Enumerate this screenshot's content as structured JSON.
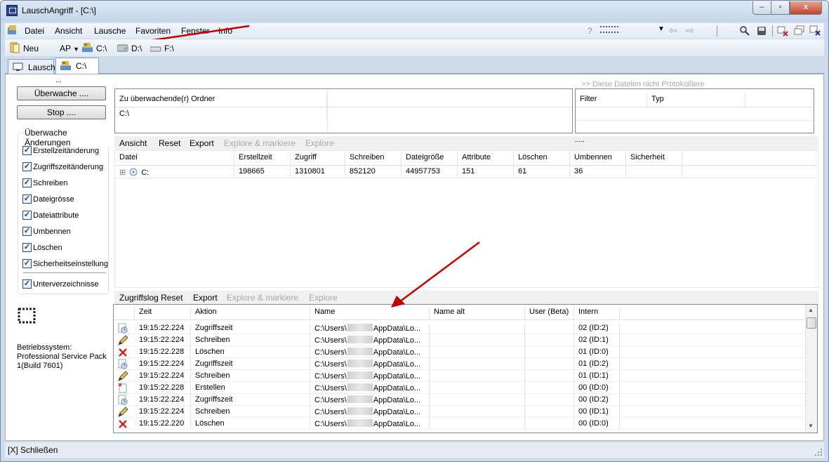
{
  "window": {
    "title": "LauschAngriff - [C:\\]",
    "min": "–",
    "max": "▫",
    "close": "x"
  },
  "menu": {
    "items": [
      "Datei",
      "Ansicht",
      "Lausche",
      "Favoriten",
      "Fenster",
      "Info"
    ],
    "help": "?"
  },
  "toolbar": {
    "new": "Neu",
    "ap": "AP",
    "drives": [
      "C:\\",
      "D:\\",
      "F:\\"
    ]
  },
  "tabs": [
    {
      "label": "Lausch"
    },
    {
      "label": "C:\\"
    }
  ],
  "left": {
    "dots": "...",
    "watch_button": "Überwache ....",
    "stop_button": "Stop ....",
    "group_label": "Überwache Änderungen",
    "checkboxes": [
      {
        "label": "Erstellzeitänderung",
        "checked": true
      },
      {
        "label": "Zugriffszeitänderung",
        "checked": true
      },
      {
        "label": "Schreiben",
        "checked": true
      },
      {
        "label": "Dateigrösse",
        "checked": true
      },
      {
        "label": "Dateiattribute",
        "checked": true
      },
      {
        "label": "Umbennen",
        "checked": true
      },
      {
        "label": "Löschen",
        "checked": true
      },
      {
        "label": "Sicherheitseinstellung",
        "checked": true
      }
    ],
    "subdirs": {
      "label": "Unterverzeichnisse",
      "checked": true
    },
    "os_label": "Betriebssystem:",
    "os_value": "Professional Service Pack 1(Build 7601)"
  },
  "folders": {
    "header": "Zu überwachende(r) Ordner",
    "value": "C:\\"
  },
  "exclude": {
    "title": ">> Diese Dateien nicht Protokolliere",
    "headers": [
      "Filter",
      "Typ"
    ]
  },
  "summary_bar": {
    "ansicht": "Ansicht",
    "reset": "Reset",
    "export": "Export",
    "explore_mark": "Explore & markiere",
    "explore": "Explore",
    "dots": "....."
  },
  "summary": {
    "headers": [
      "Datei",
      "Erstellzeit",
      "Zugriff",
      "Schreiben",
      "Dateigröße",
      "Attribute",
      "Löschen",
      "Umbennen",
      "Sicherheit"
    ],
    "row": {
      "expander": "⊞",
      "name": "C:",
      "values": [
        "198665",
        "1310801",
        "852120",
        "44957753",
        "151",
        "61",
        "36",
        ""
      ]
    }
  },
  "log_bar": {
    "reset": "Zugriffslog Reset",
    "export": "Export",
    "explore_mark": "Explore & markiere",
    "explore": "Explore"
  },
  "log": {
    "headers": [
      "Zeit",
      "Aktion",
      "Name",
      "Name alt",
      "User (Beta)",
      "Intern"
    ],
    "name_prefix": "C:\\Users\\",
    "name_suffix": "AppData\\Lo...",
    "rows": [
      {
        "icon": "access-icon",
        "time": "19:15:22.224",
        "action": "Zugriffszeit",
        "intern": "02 (ID:2)"
      },
      {
        "icon": "pencil-icon",
        "time": "19:15:22.224",
        "action": "Schreiben",
        "intern": "02 (ID:1)"
      },
      {
        "icon": "delete-icon",
        "time": "19:15:22.228",
        "action": "Löschen",
        "intern": "01 (ID:0)"
      },
      {
        "icon": "access-icon",
        "time": "19:15:22.224",
        "action": "Zugriffszeit",
        "intern": "01 (ID:2)"
      },
      {
        "icon": "pencil-icon",
        "time": "19:15:22.224",
        "action": "Schreiben",
        "intern": "01 (ID:1)"
      },
      {
        "icon": "create-icon",
        "time": "19:15:22.228",
        "action": "Erstellen",
        "intern": "00 (ID:0)"
      },
      {
        "icon": "access-icon",
        "time": "19:15:22.224",
        "action": "Zugriffszeit",
        "intern": "00 (ID:2)"
      },
      {
        "icon": "pencil-icon",
        "time": "19:15:22.224",
        "action": "Schreiben",
        "intern": "00 (ID:1)"
      },
      {
        "icon": "delete-icon",
        "time": "19:15:22.220",
        "action": "Löschen",
        "intern": "00 (ID:0)"
      }
    ]
  },
  "status": {
    "text": "[X] Schließen"
  }
}
